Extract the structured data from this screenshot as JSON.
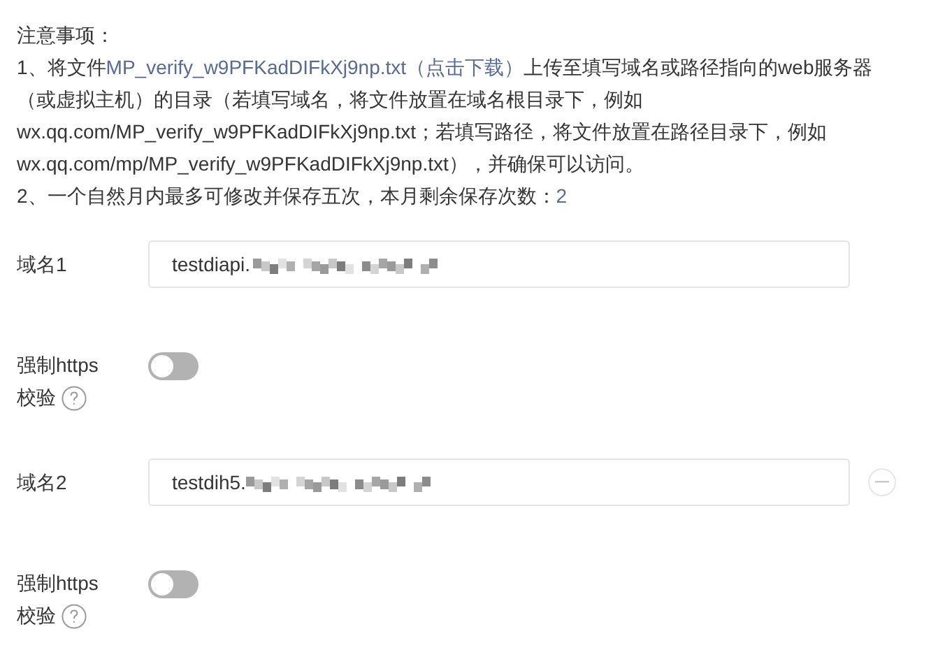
{
  "notes": {
    "title": "注意事项：",
    "item1": {
      "prefix": "1、将文件",
      "link": "MP_verify_w9PFKadDIFkXj9np.txt（点击下载）",
      "suffix": "上传至填写域名或路径指向的web服务器（或虚拟主机）的目录（若填写域名，将文件放置在域名根目录下，例如wx.qq.com/MP_verify_w9PFKadDIFkXj9np.txt；若填写路径，将文件放置在路径目录下，例如wx.qq.com/mp/MP_verify_w9PFKadDIFkXj9np.txt），并确保可以访问。"
    },
    "item2": {
      "text": "2、一个自然月内最多可修改并保存五次，本月剩余保存次数：",
      "count": "2"
    }
  },
  "domains": [
    {
      "label": "域名1",
      "value": "testdiapi.",
      "removable": false,
      "https_label": "强制https",
      "https_label2": "校验",
      "https_on": false
    },
    {
      "label": "域名2",
      "value": "testdih5.",
      "removable": true,
      "https_label": "强制https",
      "https_label2": "校验",
      "https_on": false
    }
  ]
}
